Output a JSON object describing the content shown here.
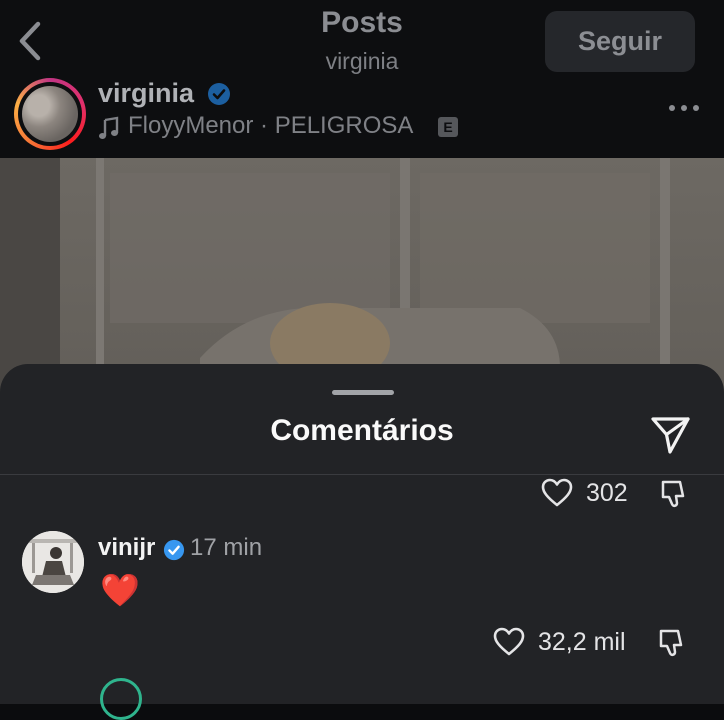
{
  "header": {
    "title": "Posts",
    "subtitle": "virginia",
    "follow_label": "Seguir"
  },
  "post": {
    "username": "virginia",
    "verified": true,
    "music": "FloyyMenor · PELIGROSA",
    "explicit_badge": "E"
  },
  "comments_sheet": {
    "title": "Comentários",
    "previous_like_count": "302",
    "comment": {
      "username": "vinijr",
      "verified": true,
      "time": "17 min",
      "text": "❤️",
      "like_count": "32,2 mil"
    }
  },
  "icons": {
    "back": "chevron-left-icon",
    "verified": "verified-badge-icon",
    "music": "music-note-icon",
    "more": "more-horizontal-icon",
    "share": "send-icon",
    "like": "heart-outline-icon",
    "dislike": "thumbs-down-icon"
  },
  "colors": {
    "sheet_background": "#222326",
    "verified_blue": "#3797f0",
    "heart_red": "#e8203a"
  }
}
